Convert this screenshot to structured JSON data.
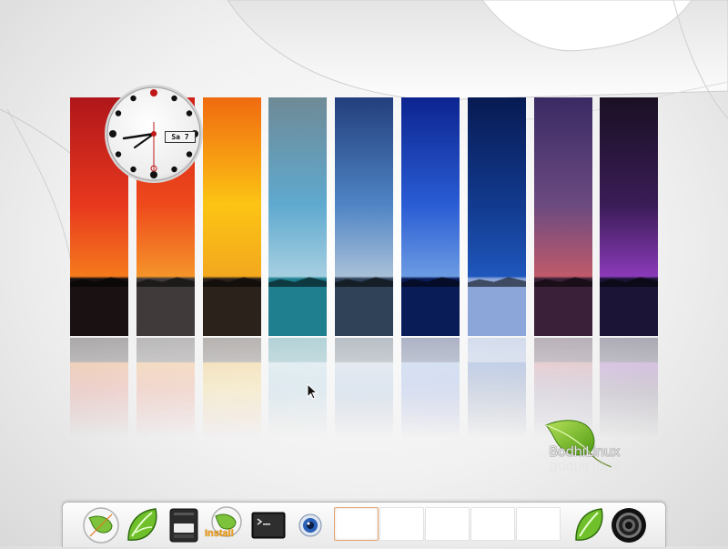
{
  "desktop": {
    "clock": {
      "date_display": "Sa 7"
    },
    "logo_text": "BodhiLinux",
    "wallpaper_panels": [
      {
        "name": "red-sunset",
        "sky_top": "#b0161a",
        "sky_mid": "#e8381e",
        "sky_bottom": "#f57a1c",
        "ground": "#1a1212"
      },
      {
        "name": "red-orange-sea",
        "sky_top": "#d22018",
        "sky_mid": "#ee4a1c",
        "sky_bottom": "#f5942a",
        "ground": "#403a3a"
      },
      {
        "name": "yellow-sun",
        "sky_top": "#f06a10",
        "sky_mid": "#fcc414",
        "sky_bottom": "#f3a81e",
        "ground": "#2c221c"
      },
      {
        "name": "teal-clouds",
        "sky_top": "#6f8a96",
        "sky_mid": "#5fa9cf",
        "sky_bottom": "#a6cfe1",
        "ground": "#1f7f8e"
      },
      {
        "name": "blue-clouds",
        "sky_top": "#233e7c",
        "sky_mid": "#4f84c4",
        "sky_bottom": "#a8c0d8",
        "ground": "#2f4258"
      },
      {
        "name": "deep-blue",
        "sky_top": "#0c2490",
        "sky_mid": "#2a5cd4",
        "sky_bottom": "#6b9be2",
        "ground": "#0a1c58"
      },
      {
        "name": "navy-snow",
        "sky_top": "#071a52",
        "sky_mid": "#123a8e",
        "sky_bottom": "#1f57bc",
        "ground": "#8ca6da"
      },
      {
        "name": "purple-dusk",
        "sky_top": "#3a2a64",
        "sky_mid": "#6b4a80",
        "sky_bottom": "#c05a6a",
        "ground": "#3a2038"
      },
      {
        "name": "dark-purple",
        "sky_top": "#1a1024",
        "sky_mid": "#3a1c56",
        "sky_bottom": "#8a3ab8",
        "ground": "#1c1436"
      }
    ]
  },
  "dock": {
    "items": [
      {
        "name": "bodhi-menu",
        "icon": "bodhi-leaf-icon"
      },
      {
        "name": "midori-browser",
        "icon": "midori-leaf-icon"
      },
      {
        "name": "file-manager",
        "icon": "file-manager-icon"
      },
      {
        "name": "install",
        "icon": "install-leaf-icon",
        "label": "Install"
      },
      {
        "name": "terminal",
        "icon": "terminal-icon"
      },
      {
        "name": "network",
        "icon": "network-icon"
      }
    ],
    "workspaces": [
      "ws1",
      "ws2",
      "ws3",
      "ws4",
      "ws5"
    ],
    "active_workspace": 0,
    "tray": [
      {
        "name": "midori-tray",
        "icon": "midori-leaf-icon"
      },
      {
        "name": "shutdown",
        "icon": "power-ring-icon"
      }
    ]
  }
}
